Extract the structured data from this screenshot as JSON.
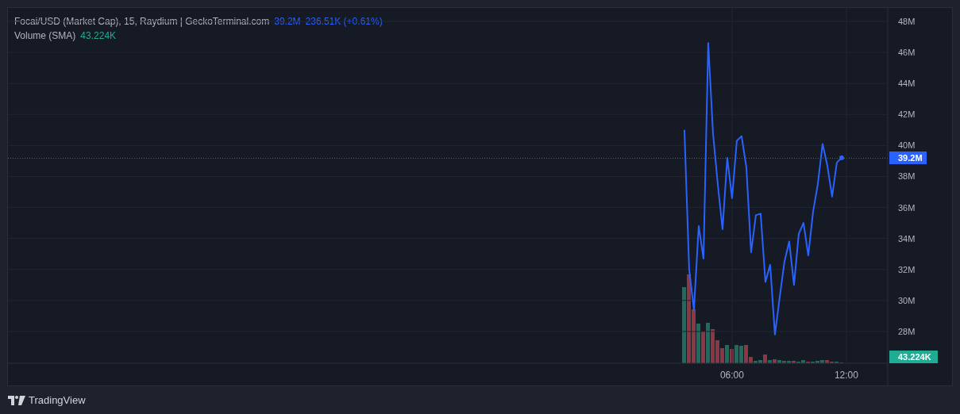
{
  "legend": {
    "title": "Focai/USD (Market Cap), 15, Raydium | GeckoTerminal.com",
    "value": "39.2M",
    "change": "236.51K (+0.61%)",
    "volume_label": "Volume (SMA)",
    "volume_value": "43.224K"
  },
  "chart_data": {
    "type": "line",
    "x": [
      3.5,
      3.75,
      4,
      4.25,
      4.5,
      4.75,
      5,
      5.25,
      5.5,
      5.75,
      6,
      6.25,
      6.5,
      6.75,
      7,
      7.25,
      7.5,
      7.75,
      8,
      8.25,
      8.5,
      8.75,
      9,
      9.25,
      9.5,
      9.75,
      10,
      10.25,
      10.5,
      10.75,
      11,
      11.25,
      11.5,
      11.75
    ],
    "xlim": [
      -32,
      14.17
    ],
    "grid": true,
    "series": [
      {
        "color": "#2962ff",
        "values": [
          41.0,
          32.0,
          29.4,
          34.8,
          32.7,
          46.6,
          40.8,
          37.5,
          34.6,
          39.2,
          36.6,
          40.3,
          40.6,
          38.6,
          33.1,
          35.5,
          35.6,
          31.2,
          32.3,
          27.8,
          30.2,
          32.5,
          33.8,
          31.0,
          34.3,
          35.0,
          32.9,
          35.7,
          37.5,
          40.1,
          38.7,
          36.7,
          38.9,
          39.2
        ]
      }
    ],
    "ylim": [
      25.95,
      48.87
    ],
    "yticks": [
      {
        "value": 28,
        "label": "28M"
      },
      {
        "value": 30,
        "label": "30M"
      },
      {
        "value": 32,
        "label": "32M"
      },
      {
        "value": 34,
        "label": "34M"
      },
      {
        "value": 36,
        "label": "36M"
      },
      {
        "value": 38,
        "label": "38M"
      },
      {
        "value": 40,
        "label": "40M"
      },
      {
        "value": 42,
        "label": "42M"
      },
      {
        "value": 44,
        "label": "44M"
      },
      {
        "value": 46,
        "label": "46M"
      },
      {
        "value": 48,
        "label": "48M"
      }
    ],
    "xticks": [
      {
        "value": 6,
        "label": "06:00"
      },
      {
        "value": 12,
        "label": "12:00"
      }
    ]
  },
  "price_label": "39.2M",
  "volume_label": "43.224K",
  "footer": {
    "brand": "TradingView"
  }
}
